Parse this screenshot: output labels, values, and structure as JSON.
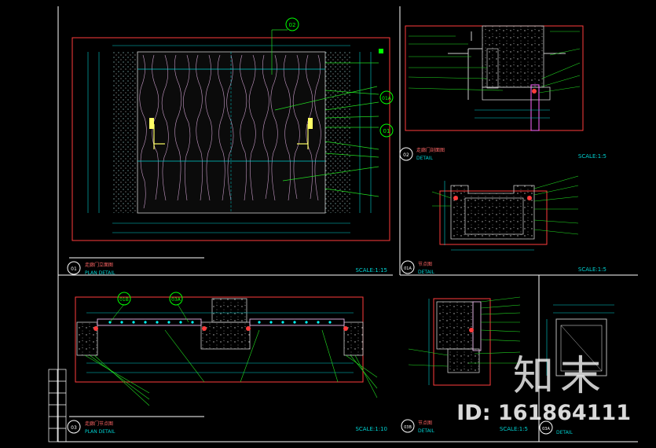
{
  "callouts": {
    "d02": "02",
    "d01a": "01A",
    "d01": "01",
    "d01b": "01B",
    "d03a": "03A"
  },
  "panels": {
    "p01": {
      "num": "01",
      "title": "走廊门立面图",
      "sub": "PLAN DETAIL",
      "scale": "SCALE:1:15"
    },
    "p02": {
      "num": "02",
      "title": "走廊门剖面图",
      "sub": "DETAIL",
      "scale": "SCALE:1:5"
    },
    "p01a": {
      "num": "01A",
      "title": "节点图",
      "sub": "DETAIL",
      "scale": "SCALE:1:5"
    },
    "p03": {
      "num": "03",
      "title": "走廊门节点图",
      "sub": "PLAN DETAIL",
      "scale": "SCALE:1:10"
    },
    "p03b": {
      "num": "03B",
      "title": "节点图",
      "sub": "DETAIL",
      "scale": "SCALE:1:5"
    },
    "p03a": {
      "num": "03A",
      "title": "",
      "sub": "DETAIL",
      "scale": ""
    }
  },
  "watermark": {
    "logo": "知末",
    "id": "ID: 161864111"
  },
  "colors": {
    "bg": "#000000",
    "border": "#ffffff",
    "frame": "#ff3b3b",
    "dim": "#00d0d0",
    "leader": "#22dd22",
    "wood": "#e8b4e8",
    "text": "#ffff66"
  }
}
